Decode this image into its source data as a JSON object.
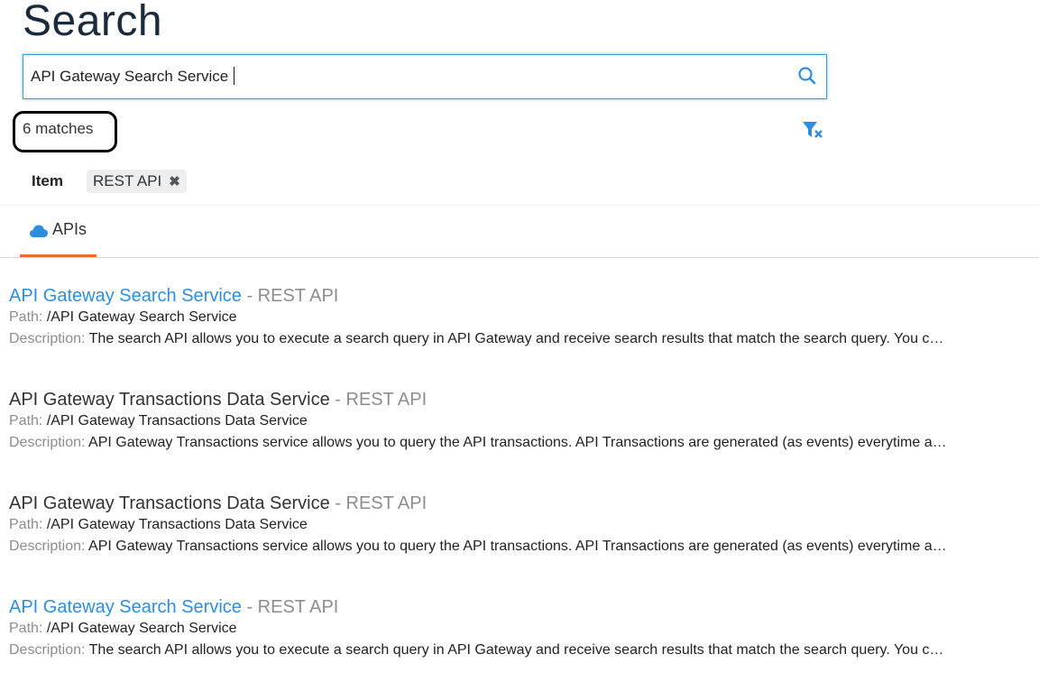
{
  "page": {
    "title": "Search"
  },
  "search": {
    "value": "API Gateway Search Service"
  },
  "results_info": {
    "count_text": "6 matches"
  },
  "facets": {
    "label": "Item",
    "chips": [
      {
        "label": "REST API",
        "remove_glyph": "✖"
      }
    ]
  },
  "tabs": [
    {
      "label": "APIs",
      "icon": "cloud-icon",
      "active": true
    }
  ],
  "colors": {
    "link": "#2d8ee0",
    "accent": "#ec6a36",
    "focus": "#3b9ad9"
  },
  "results": [
    {
      "name": "API Gateway Search Service",
      "separator": " - ",
      "type": "REST API",
      "path_label": "Path: ",
      "path": "/API Gateway Search Service",
      "description_label": "Description: ",
      "description": "The search API allows you to execute a search query in API Gateway and receive search results that match the search query. You c…",
      "is_link": true
    },
    {
      "name": "API Gateway Transactions Data Service",
      "separator": " - ",
      "type": "REST API",
      "path_label": "Path: ",
      "path": "/API Gateway Transactions Data Service",
      "description_label": "Description: ",
      "description": "API Gateway Transactions service allows you to query the API transactions. API Transactions are generated (as events) everytime a…",
      "is_link": false
    },
    {
      "name": "API Gateway Transactions Data Service",
      "separator": " - ",
      "type": "REST API",
      "path_label": "Path: ",
      "path": "/API Gateway Transactions Data Service",
      "description_label": "Description: ",
      "description": "API Gateway Transactions service allows you to query the API transactions. API Transactions are generated (as events) everytime a…",
      "is_link": false
    },
    {
      "name": "API Gateway Search Service",
      "separator": " - ",
      "type": "REST API",
      "path_label": "Path: ",
      "path": "/API Gateway Search Service",
      "description_label": "Description: ",
      "description": "The search API allows you to execute a search query in API Gateway and receive search results that match the search query. You c…",
      "is_link": true
    }
  ]
}
